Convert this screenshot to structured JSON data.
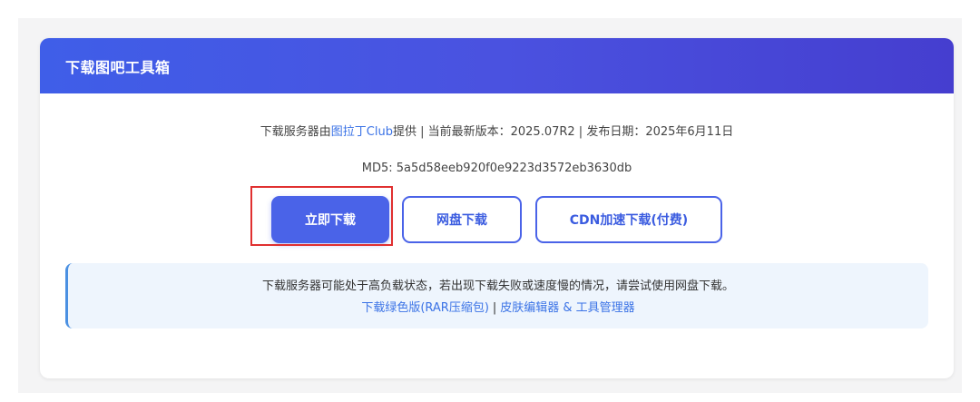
{
  "header": {
    "title": "下载图吧工具箱"
  },
  "info": {
    "server_prefix": "下载服务器由",
    "server_link": "图拉丁Club",
    "server_suffix": "提供 | 当前最新版本：2025.07R2 | 发布日期：2025年6月11日",
    "md5": "MD5: 5a5d58eeb920f0e9223d3572eb3630db"
  },
  "buttons": {
    "download_now": "立即下载",
    "netdisk": "网盘下载",
    "cdn": "CDN加速下载(付费)"
  },
  "notice": {
    "text": "下载服务器可能处于高负载状态，若出现下载失败或速度慢的情况，请尝试使用网盘下载。",
    "link_green": "下载绿色版(RAR压缩包)",
    "separator": "|",
    "link_tools": "皮肤编辑器 & 工具管理器"
  },
  "colors": {
    "header_gradient_start": "#3f5ee8",
    "header_gradient_end": "#453ecf",
    "primary": "#4a63e8",
    "link": "#3b73e6",
    "highlight": "#e03030",
    "notice_bg": "#eef5fd"
  }
}
